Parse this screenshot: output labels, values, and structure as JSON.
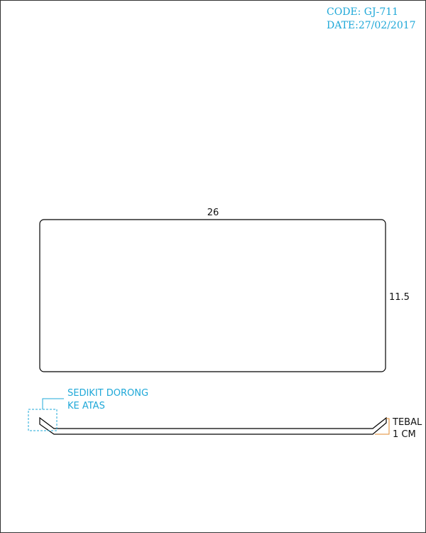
{
  "header": {
    "code": "CODE: GJ-711",
    "date": "DATE:27/02/2017"
  },
  "top_view": {
    "width_label": "26",
    "height_label": "11.5"
  },
  "side_view": {
    "note_line1": "SEDIKIT DORONG",
    "note_line2": "KE ATAS",
    "thickness_line1": "TEBAL",
    "thickness_line2": "1 CM"
  },
  "colors": {
    "annotation": "#1fa8d8",
    "thickness_marker": "#e08a2c",
    "outline": "#000000"
  }
}
